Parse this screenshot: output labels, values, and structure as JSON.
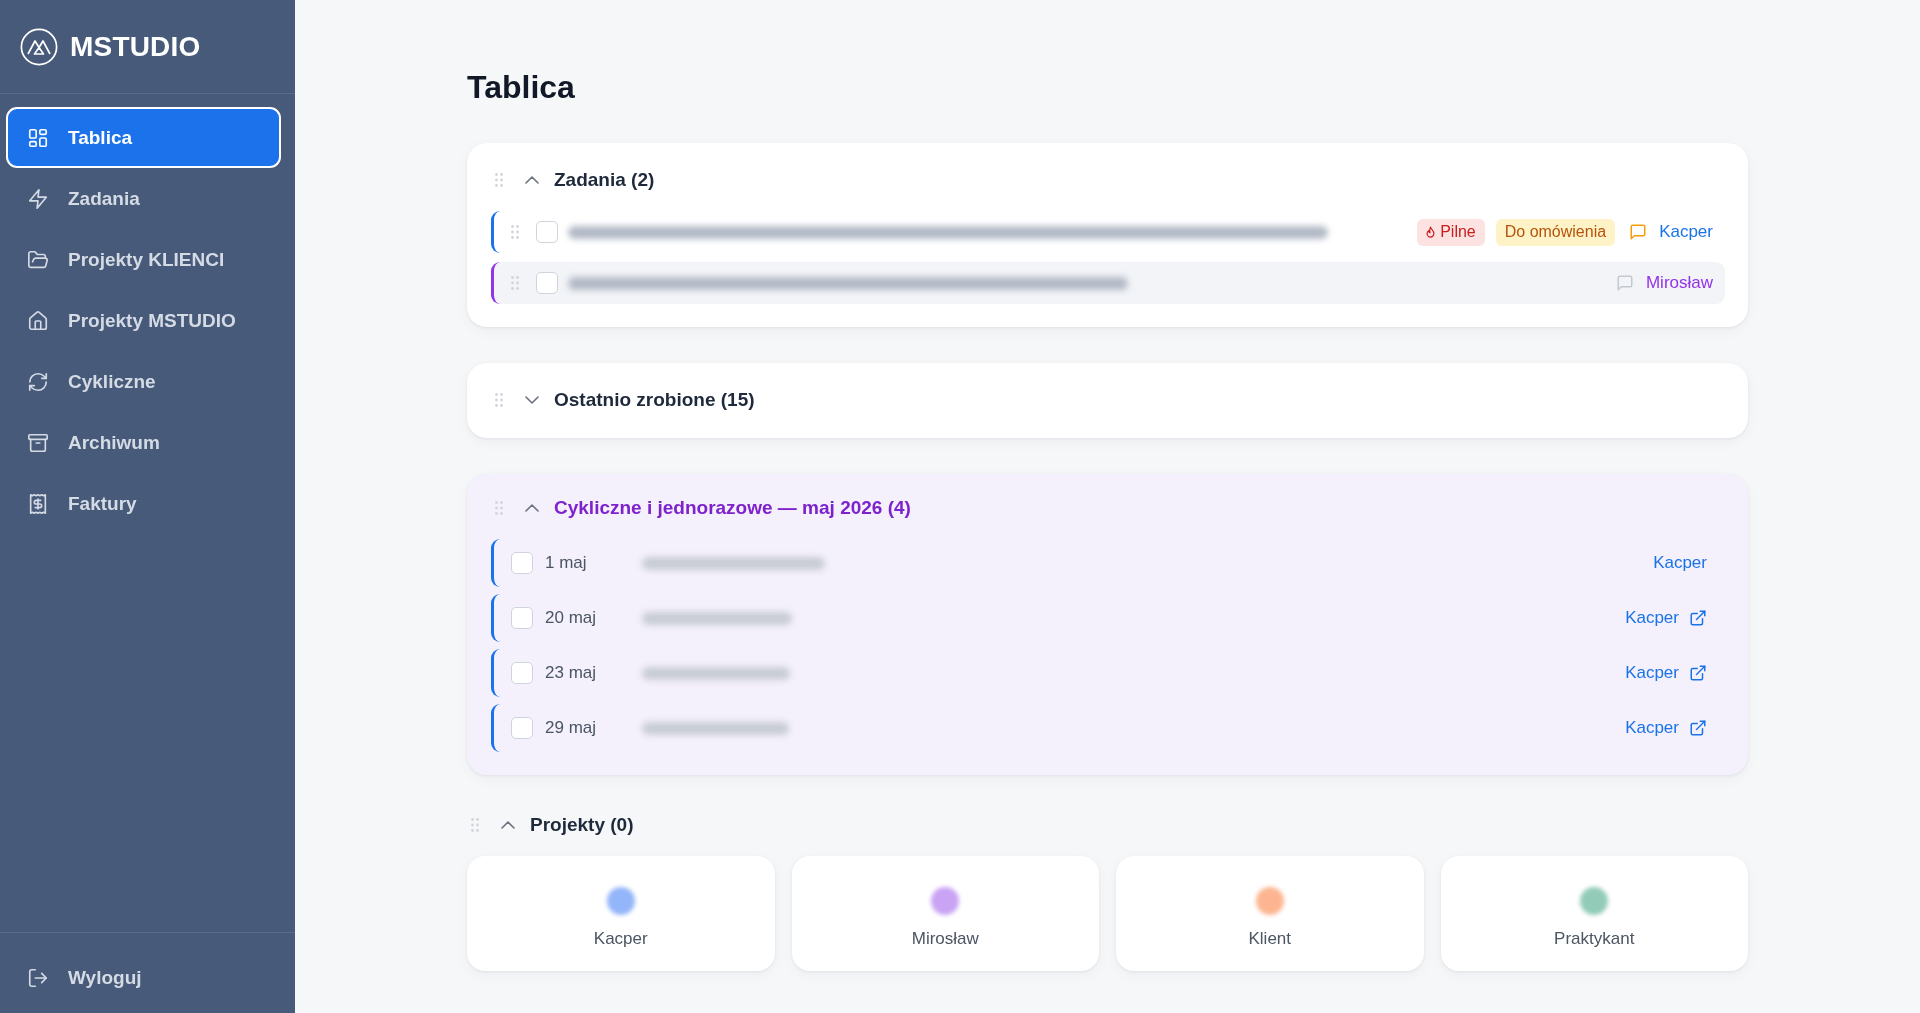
{
  "sidebar": {
    "brand": "MSTUDIO",
    "items": [
      {
        "label": "Tablica",
        "selected": true
      },
      {
        "label": "Zadania",
        "selected": false
      },
      {
        "label": "Projekty KLIENCI",
        "selected": false
      },
      {
        "label": "Projekty MSTUDIO",
        "selected": false
      },
      {
        "label": "Cykliczne",
        "selected": false
      },
      {
        "label": "Archiwum",
        "selected": false
      },
      {
        "label": "Faktury",
        "selected": false
      }
    ],
    "logout": "Wyloguj"
  },
  "main": {
    "title": "Tablica",
    "sections": [
      {
        "kind": "tasks",
        "title": "Zadania (2)",
        "expanded": true,
        "tasks": [
          {
            "checked": false,
            "color": "#1a73e8",
            "hovered": false,
            "tags": [
              {
                "kind": "urgent",
                "label": "Pilne"
              },
              {
                "kind": "discuss",
                "label": "Do omówienia"
              }
            ],
            "comment_active": true,
            "assignee": "Kacper"
          },
          {
            "checked": false,
            "color": "#9333ea",
            "hovered": true,
            "comment_active": false,
            "assignee": "Mirosław"
          }
        ]
      },
      {
        "kind": "recent",
        "title": "Ostatnio zrobione (15)",
        "expanded": false
      },
      {
        "kind": "cyclic",
        "title": "Cykliczne i jednorazowe — maj 2026 (4)",
        "expanded": true,
        "entries": [
          {
            "date": "1 maj",
            "checked": false,
            "assignee": "Kacper",
            "has_link": false
          },
          {
            "date": "20 maj",
            "checked": false,
            "assignee": "Kacper",
            "has_link": true
          },
          {
            "date": "23 maj",
            "checked": false,
            "assignee": "Kacper",
            "has_link": true
          },
          {
            "date": "29 maj",
            "checked": false,
            "assignee": "Kacper",
            "has_link": true
          }
        ]
      },
      {
        "kind": "projects",
        "title": "Projekty (0)",
        "expanded": true,
        "people": [
          {
            "name": "Kacper",
            "color": "#93b5f9"
          },
          {
            "name": "Mirosław",
            "color": "#c9a3f4"
          },
          {
            "name": "Klient",
            "color": "#fcb590"
          },
          {
            "name": "Praktykant",
            "color": "#92cbb8"
          }
        ]
      }
    ]
  }
}
